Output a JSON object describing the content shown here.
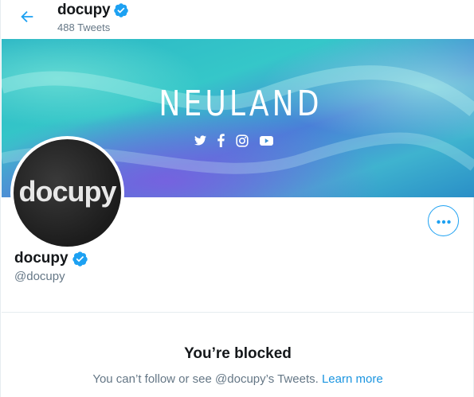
{
  "header": {
    "name": "docupy",
    "tweet_count": "488 Tweets"
  },
  "banner": {
    "title": "NEULAND",
    "social_icons": [
      "twitter-icon",
      "facebook-icon",
      "instagram-icon",
      "youtube-icon"
    ]
  },
  "avatar": {
    "text": "docupy"
  },
  "profile": {
    "name": "docupy",
    "handle": "@docupy"
  },
  "blocked": {
    "title": "You’re blocked",
    "message": "You can’t follow or see @docupy’s Tweets.",
    "learn_more": "Learn more"
  },
  "colors": {
    "accent": "#1da1f2",
    "link": "#1b95e0",
    "secondary_text": "#657786"
  }
}
